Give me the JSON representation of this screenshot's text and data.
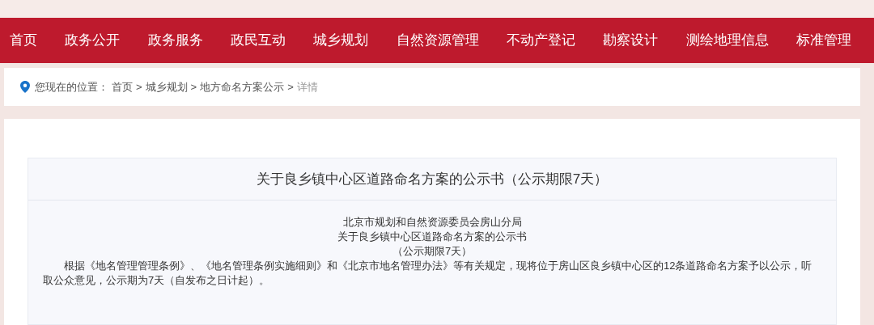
{
  "nav": [
    {
      "label": "首页"
    },
    {
      "label": "政务公开"
    },
    {
      "label": "政务服务"
    },
    {
      "label": "政民互动"
    },
    {
      "label": "城乡规划"
    },
    {
      "label": "自然资源管理"
    },
    {
      "label": "不动产登记"
    },
    {
      "label": "勘察设计"
    },
    {
      "label": "测绘地理信息"
    },
    {
      "label": "标准管理"
    }
  ],
  "breadcrumb": {
    "prefix": "您现在的位置：",
    "items": [
      "首页",
      "城乡规划",
      "地方命名方案公示",
      "详情"
    ],
    "separator": ">"
  },
  "article": {
    "title": "关于良乡镇中心区道路命名方案的公示书（公示期限7天）",
    "header_lines": [
      "北京市规划和自然资源委员会房山分局",
      "关于良乡镇中心区道路命名方案的公示书",
      "（公示期限7天）"
    ],
    "paragraph": "根据《地名管理管理条例》、《地名管理条例实施细则》和《北京市地名管理办法》等有关规定，现将位于房山区良乡镇中心区的12条道路命名方案予以公示，听取公众意见，公示期为7天（自发布之日计起）。"
  }
}
